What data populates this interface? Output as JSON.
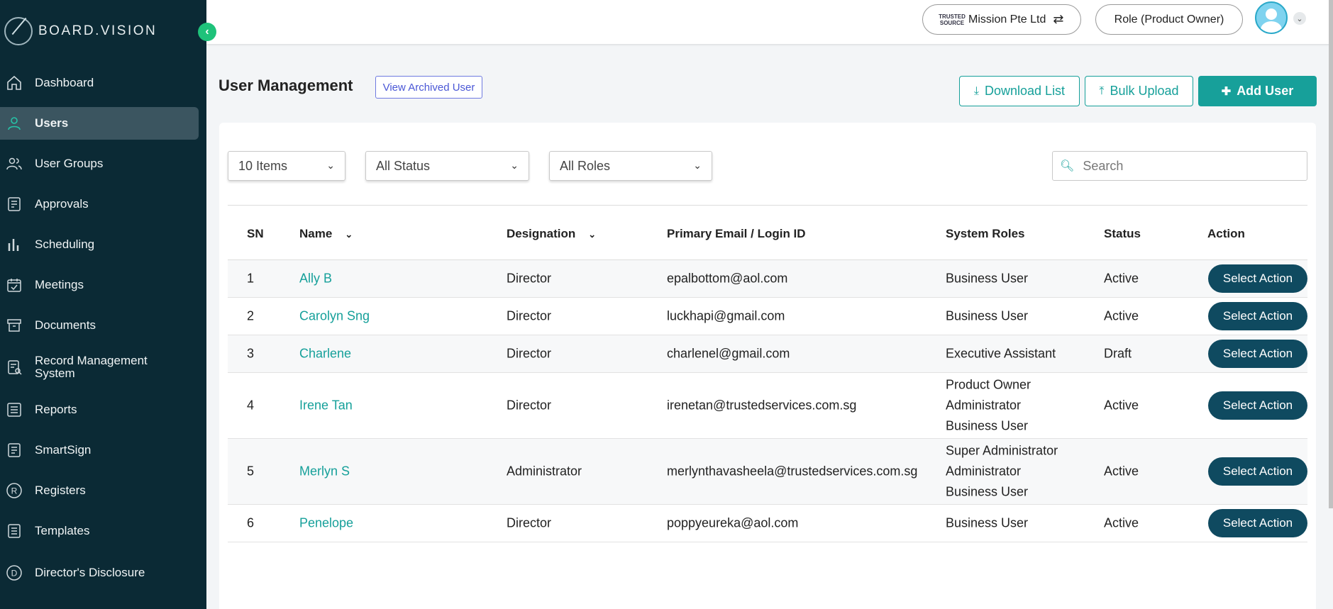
{
  "brand": {
    "name": "BOARD.VISION"
  },
  "sidebar": {
    "items": [
      {
        "label": "Dashboard",
        "icon": "home-icon"
      },
      {
        "label": "Users",
        "icon": "user-icon",
        "active": true
      },
      {
        "label": "User Groups",
        "icon": "users-icon"
      },
      {
        "label": "Approvals",
        "icon": "document-check-icon"
      },
      {
        "label": "Scheduling",
        "icon": "bar-chart-icon"
      },
      {
        "label": "Meetings",
        "icon": "calendar-check-icon"
      },
      {
        "label": "Documents",
        "icon": "archive-box-icon"
      },
      {
        "label": "Record Management System",
        "icon": "document-search-icon"
      },
      {
        "label": "Reports",
        "icon": "list-icon"
      },
      {
        "label": "SmartSign",
        "icon": "signature-doc-icon"
      },
      {
        "label": "Registers",
        "icon": "registered-circle-icon"
      },
      {
        "label": "Templates",
        "icon": "template-icon"
      },
      {
        "label": "Director's Disclosure",
        "icon": "d-circle-icon"
      }
    ]
  },
  "topbar": {
    "org_logo_text": "TRUSTED SOURCE",
    "org_name": "Mission Pte Ltd",
    "role": "Role (Product Owner)"
  },
  "header": {
    "title": "User Management",
    "archived_label": "View Archived User",
    "download_label": "Download List",
    "upload_label": "Bulk Upload",
    "add_label": "Add User"
  },
  "filters": {
    "items": "10 Items",
    "status": "All Status",
    "roles": "All Roles",
    "search_placeholder": "Search"
  },
  "table": {
    "columns": [
      "SN",
      "Name",
      "Designation",
      "Primary Email / Login ID",
      "System Roles",
      "Status",
      "Action"
    ],
    "action_label": "Select Action",
    "rows": [
      {
        "sn": "1",
        "name": "Ally B",
        "designation": "Director",
        "email": "epalbottom@aol.com",
        "roles": [
          "Business User"
        ],
        "status": "Active"
      },
      {
        "sn": "2",
        "name": "Carolyn Sng",
        "designation": "Director",
        "email": "luckhapi@gmail.com",
        "roles": [
          "Business User"
        ],
        "status": "Active"
      },
      {
        "sn": "3",
        "name": "Charlene",
        "designation": "Director",
        "email": "charlenel@gmail.com",
        "roles": [
          "Executive Assistant"
        ],
        "status": "Draft"
      },
      {
        "sn": "4",
        "name": "Irene Tan",
        "designation": "Director",
        "email": "irenetan@trustedservices.com.sg",
        "roles": [
          "Product Owner",
          "Administrator",
          "Business User"
        ],
        "status": "Active"
      },
      {
        "sn": "5",
        "name": "Merlyn S",
        "designation": "Administrator",
        "email": "merlynthavasheela@trustedservices.com.sg",
        "roles": [
          "Super Administrator",
          "Administrator",
          "Business User"
        ],
        "status": "Active"
      },
      {
        "sn": "6",
        "name": "Penelope",
        "designation": "Director",
        "email": "poppyeureka@aol.com",
        "roles": [
          "Business User"
        ],
        "status": "Active"
      }
    ]
  }
}
